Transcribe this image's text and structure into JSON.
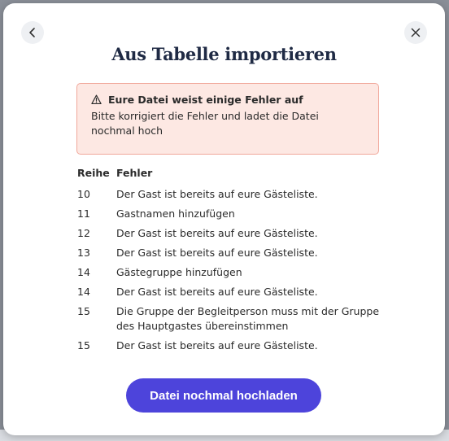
{
  "modal": {
    "title": "Aus Tabelle importieren",
    "back_icon": "chevron-left-icon",
    "close_icon": "close-icon"
  },
  "alert": {
    "icon": "warning-icon",
    "heading": "Eure Datei weist einige Fehler auf",
    "message": "Bitte korrigiert die Fehler und ladet die Datei nochmal hoch"
  },
  "table": {
    "columns": {
      "row": "Reihe",
      "error": "Fehler"
    },
    "rows": [
      {
        "row": "10",
        "error": "Der Gast ist bereits auf eure Gästeliste."
      },
      {
        "row": "11",
        "error": "Gastnamen hinzufügen"
      },
      {
        "row": "12",
        "error": "Der Gast ist bereits auf eure Gästeliste."
      },
      {
        "row": "13",
        "error": "Der Gast ist bereits auf eure Gästeliste."
      },
      {
        "row": "14",
        "error": "Gästegruppe hinzufügen"
      },
      {
        "row": "14",
        "error": "Der Gast ist bereits auf eure Gästeliste."
      },
      {
        "row": "15",
        "error": "Die Gruppe der Begleitperson muss mit der Gruppe des Hauptgastes übereinstimmen"
      },
      {
        "row": "15",
        "error": "Der Gast ist bereits auf eure Gästeliste."
      }
    ]
  },
  "actions": {
    "reupload_label": "Datei nochmal hochladen"
  },
  "colors": {
    "primary": "#4d44db",
    "alert_bg": "#fde8e3",
    "alert_border": "#f1a79a",
    "title": "#1f2a44"
  }
}
